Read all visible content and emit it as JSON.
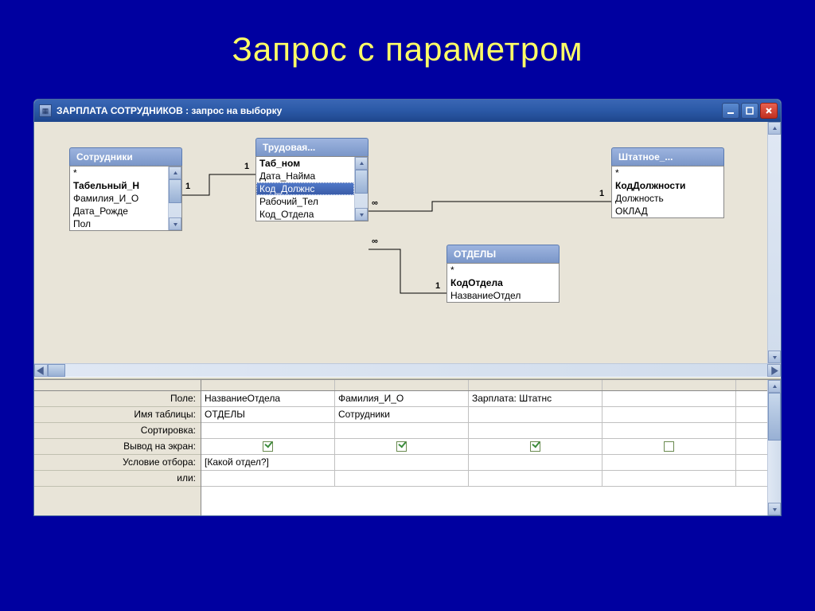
{
  "slide": {
    "title": "Запрос с параметром"
  },
  "window": {
    "title": "ЗАРПЛАТА СОТРУДНИКОВ : запрос на выборку"
  },
  "tables": {
    "employees": {
      "title": "Сотрудники",
      "fields": [
        "*",
        "Табельный_Н",
        "Фамилия_И_О",
        "Дата_Рожде",
        "Пол"
      ]
    },
    "labor": {
      "title": "Трудовая...",
      "fields": [
        "Таб_ном",
        "Дата_Найма",
        "Код_Должнс",
        "Рабочий_Тел",
        "Код_Отдела"
      ]
    },
    "departments": {
      "title": "ОТДЕЛЫ",
      "fields": [
        "*",
        "КодОтдела",
        "НазваниеОтдел"
      ]
    },
    "staff": {
      "title": "Штатное_...",
      "fields": [
        "*",
        "КодДолжности",
        "Должность",
        "ОКЛАД"
      ]
    }
  },
  "relations": {
    "one": "1",
    "many": "∞"
  },
  "grid": {
    "row_labels": [
      "Поле:",
      "Имя таблицы:",
      "Сортировка:",
      "Вывод на экран:",
      "Условие отбора:",
      "или:"
    ],
    "columns": [
      {
        "field": "НазваниеОтдела",
        "table": "ОТДЕЛЫ",
        "sort": "",
        "show": true,
        "criteria": "[Какой отдел?]",
        "or": ""
      },
      {
        "field": "Фамилия_И_О",
        "table": "Сотрудники",
        "sort": "",
        "show": true,
        "criteria": "",
        "or": ""
      },
      {
        "field": "Зарплата: Штатнс",
        "table": "",
        "sort": "",
        "show": true,
        "criteria": "",
        "or": ""
      },
      {
        "field": "",
        "table": "",
        "sort": "",
        "show": false,
        "criteria": "",
        "or": ""
      }
    ]
  }
}
